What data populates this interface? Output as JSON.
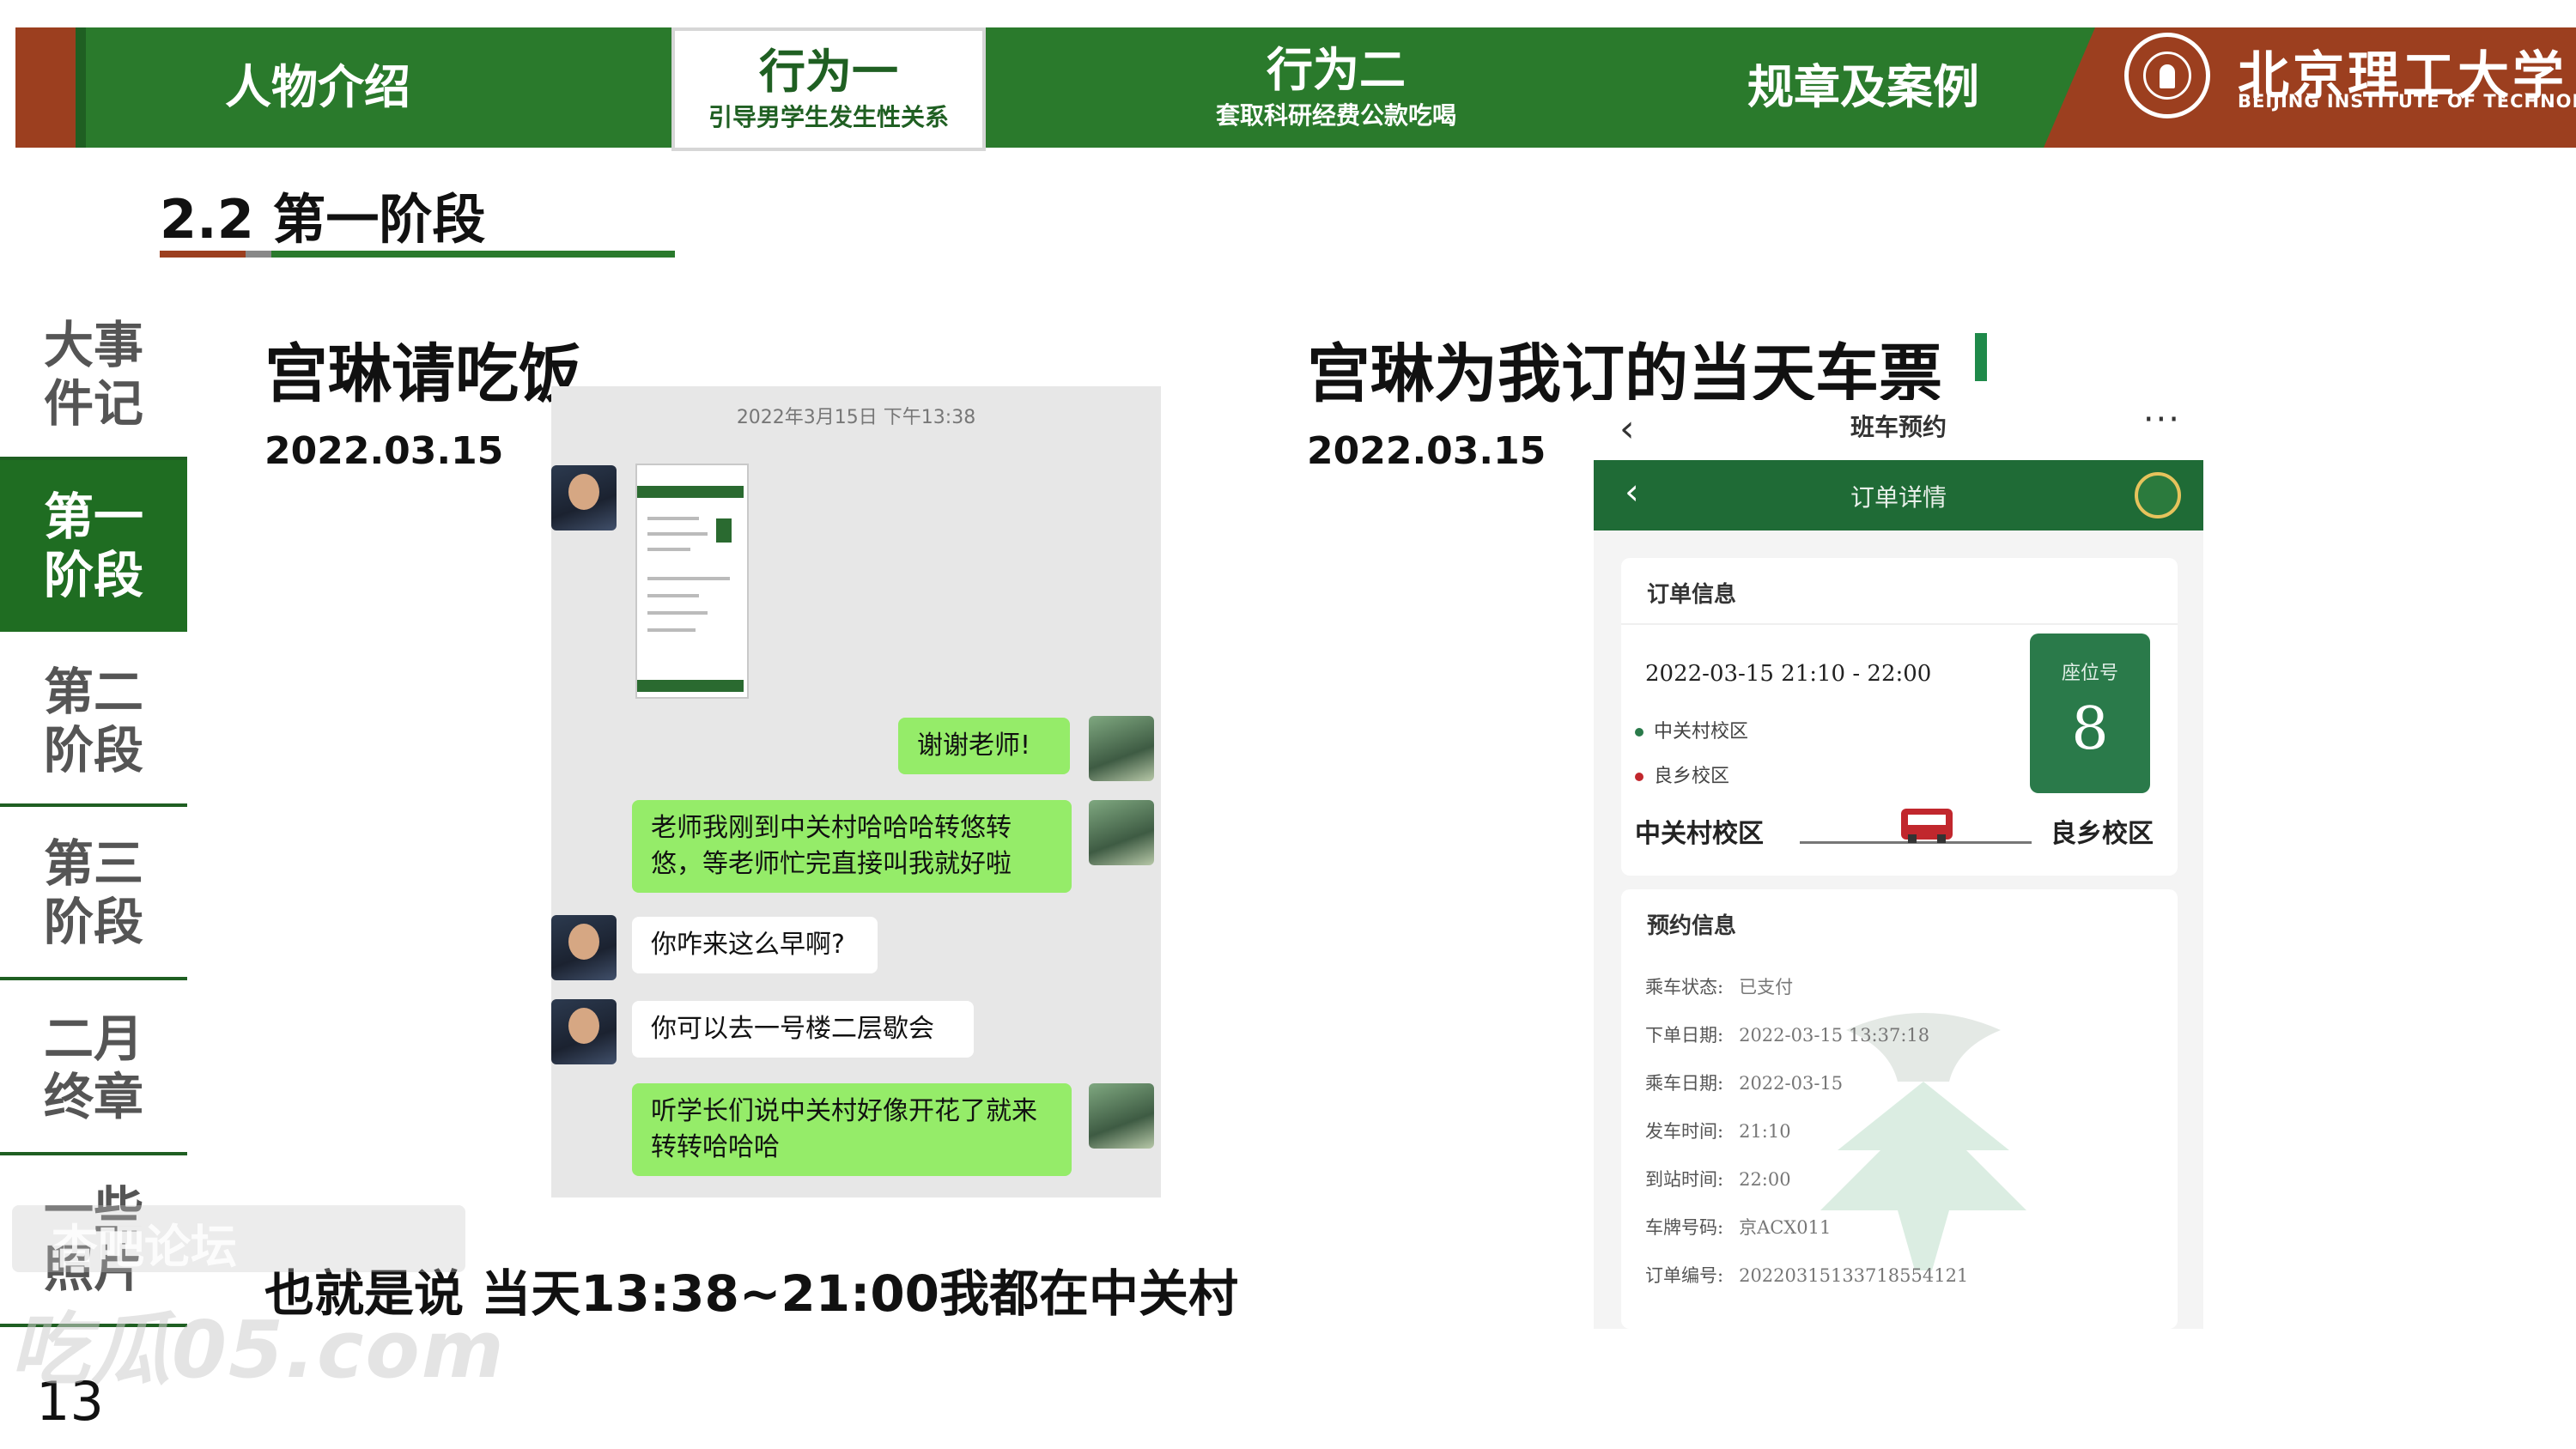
{
  "nav": {
    "tabs": [
      {
        "title": "人物介绍",
        "subtitle": ""
      },
      {
        "title": "行为一",
        "subtitle": "引导男学生发生性关系"
      },
      {
        "title": "行为二",
        "subtitle": "套取科研经费公款吃喝"
      },
      {
        "title": "规章及案例",
        "subtitle": ""
      }
    ],
    "active_index": 1
  },
  "logo": {
    "cn": "北京理工大学",
    "en": "BEIJING INSTITUTE OF TECHNOLOGY"
  },
  "section_title": "2.2 第一阶段",
  "sidebar": {
    "items": [
      "大事件记",
      "第一阶段",
      "第二阶段",
      "第三阶段",
      "二月终章",
      "一些照片"
    ],
    "active_index": 1
  },
  "page_number": "13",
  "left": {
    "heading": "宫琳请吃饭",
    "date": "2022.03.15",
    "chat": {
      "timestamp": "2022年3月15日 下午13:38",
      "messages": [
        "谢谢老师!",
        "老师我刚到中关村哈哈哈转悠转悠，等老师忙完直接叫我就好啦",
        "你咋来这么早啊?",
        "你可以去一号楼二层歇会",
        "听学长们说中关村好像开花了就来转转哈哈哈"
      ]
    },
    "caption": "也就是说 当天13:38~21:00我都在中关村"
  },
  "right": {
    "heading": "宫琳为我订的当天车票",
    "date": "2022.03.15",
    "phone": {
      "top_title": "班车预约",
      "more": "···",
      "header_title": "订单详情",
      "order_card_title": "订单信息",
      "trip_time": "2022-03-15    21:10 - 22:00",
      "from_small": "中关村校区",
      "to_small": "良乡校区",
      "seat_label": "座位号",
      "seat_number": "8",
      "route_from": "中关村校区",
      "route_to": "良乡校区",
      "booking_card_title": "预约信息",
      "info": [
        {
          "k": "乘车状态:",
          "v": "已支付"
        },
        {
          "k": "下单日期:",
          "v": "2022-03-15 13:37:18"
        },
        {
          "k": "乘车日期:",
          "v": "2022-03-15"
        },
        {
          "k": "发车时间:",
          "v": "21:10"
        },
        {
          "k": "到站时间:",
          "v": "22:00"
        },
        {
          "k": "车牌号码:",
          "v": "京ACX011"
        },
        {
          "k": "订单编号:",
          "v": "20220315133718554121"
        }
      ]
    }
  },
  "watermark": {
    "line1": "杏吧论坛",
    "line2": "吃瓜05.com"
  },
  "colors": {
    "primary_green": "#2a7a2c",
    "dark_green": "#1f6d22",
    "brick": "#9c3f1f",
    "wechat_green": "#95ec69",
    "seat_green": "#2a7a4a",
    "bus_red": "#c1272d"
  }
}
